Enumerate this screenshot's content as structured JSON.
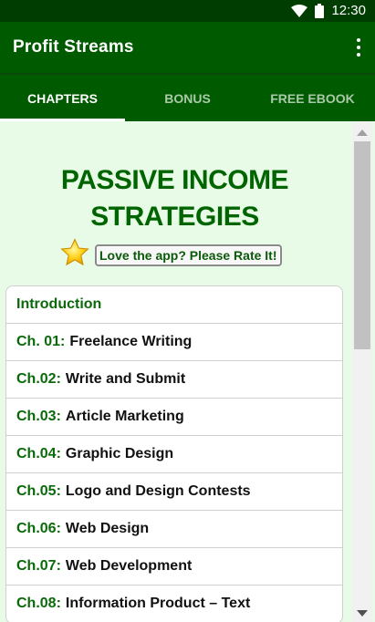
{
  "status_bar": {
    "time": "12:30",
    "icons": [
      "wifi-icon",
      "battery-icon"
    ]
  },
  "app_bar": {
    "title": "Profit Streams",
    "menu_icon": "more-vert-icon"
  },
  "tabs": [
    {
      "label": "CHAPTERS",
      "active": true
    },
    {
      "label": "BONUS",
      "active": false
    },
    {
      "label": "FREE EBOOK",
      "active": false
    }
  ],
  "headline": {
    "line1": "PASSIVE INCOME",
    "line2": "STRATEGIES"
  },
  "rate": {
    "icon": "star-icon",
    "label": "Love the app? Please Rate It!"
  },
  "intro": {
    "label": "Introduction"
  },
  "chapters": [
    {
      "num": "Ch. 01:",
      "title": "Freelance Writing"
    },
    {
      "num": "Ch.02:",
      "title": "Write and Submit"
    },
    {
      "num": "Ch.03:",
      "title": "Article Marketing"
    },
    {
      "num": "Ch.04:",
      "title": "Graphic Design"
    },
    {
      "num": "Ch.05:",
      "title": "Logo and Design Contests"
    },
    {
      "num": "Ch.06:",
      "title": "Web Design"
    },
    {
      "num": "Ch.07:",
      "title": "Web Development"
    },
    {
      "num": "Ch.08:",
      "title": "Information Product – Text"
    }
  ],
  "colors": {
    "app_bar": "#005b00",
    "status_bar": "#003d00",
    "accent_text": "#006400",
    "content_bg": "#e8fbe6"
  }
}
